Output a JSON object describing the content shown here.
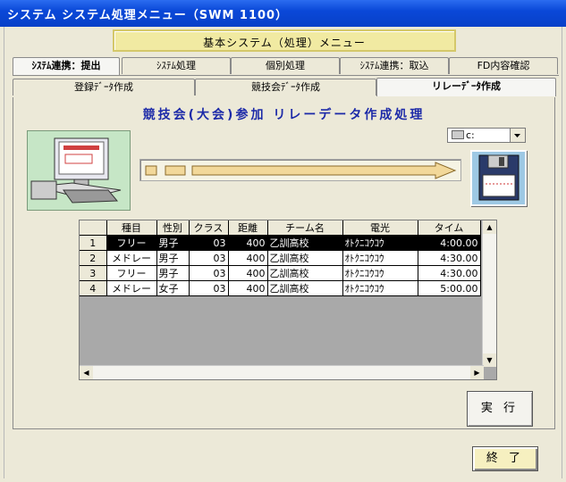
{
  "window": {
    "title": "システム  システム処理メニュー（SWM 1100）"
  },
  "banner": {
    "text": "基本システム（処理）メニュー"
  },
  "tabs_top": [
    {
      "label": "ｼｽﾃﾑ連携：提出",
      "active": true
    },
    {
      "label": "ｼｽﾃﾑ処理"
    },
    {
      "label": "個別処理"
    },
    {
      "label": "ｼｽﾃﾑ連携：取込"
    },
    {
      "label": "FD内容確認"
    }
  ],
  "tabs_sub": [
    {
      "label": "登録ﾃﾞｰﾀ作成"
    },
    {
      "label": "競技会ﾃﾞｰﾀ作成"
    },
    {
      "label": "リレーﾃﾞｰﾀ作成",
      "active": true
    }
  ],
  "heading": "競技会(大会)参加 リレーデータ作成処理",
  "drive": {
    "value": "c:"
  },
  "grid": {
    "columns": [
      "種目",
      "性別",
      "クラス",
      "距離",
      "チーム名",
      "電光",
      "タイム"
    ],
    "rows": [
      {
        "n": "1",
        "cells": [
          "フリー",
          "男子",
          "03",
          "400",
          "乙訓高校",
          "ｵﾄｸﾆｺｳｺｳ",
          "4:00.00"
        ],
        "selected": true
      },
      {
        "n": "2",
        "cells": [
          "メドレー",
          "男子",
          "03",
          "400",
          "乙訓高校",
          "ｵﾄｸﾆｺｳｺｳ",
          "4:30.00"
        ]
      },
      {
        "n": "3",
        "cells": [
          "フリー",
          "男子",
          "03",
          "400",
          "乙訓高校",
          "ｵﾄｸﾆｺｳｺｳ",
          "4:30.00"
        ]
      },
      {
        "n": "4",
        "cells": [
          "メドレー",
          "女子",
          "03",
          "400",
          "乙訓高校",
          "ｵﾄｸﾆｺｳｺｳ",
          "5:00.00"
        ]
      }
    ]
  },
  "buttons": {
    "execute": "実 行",
    "end": "終 了"
  }
}
